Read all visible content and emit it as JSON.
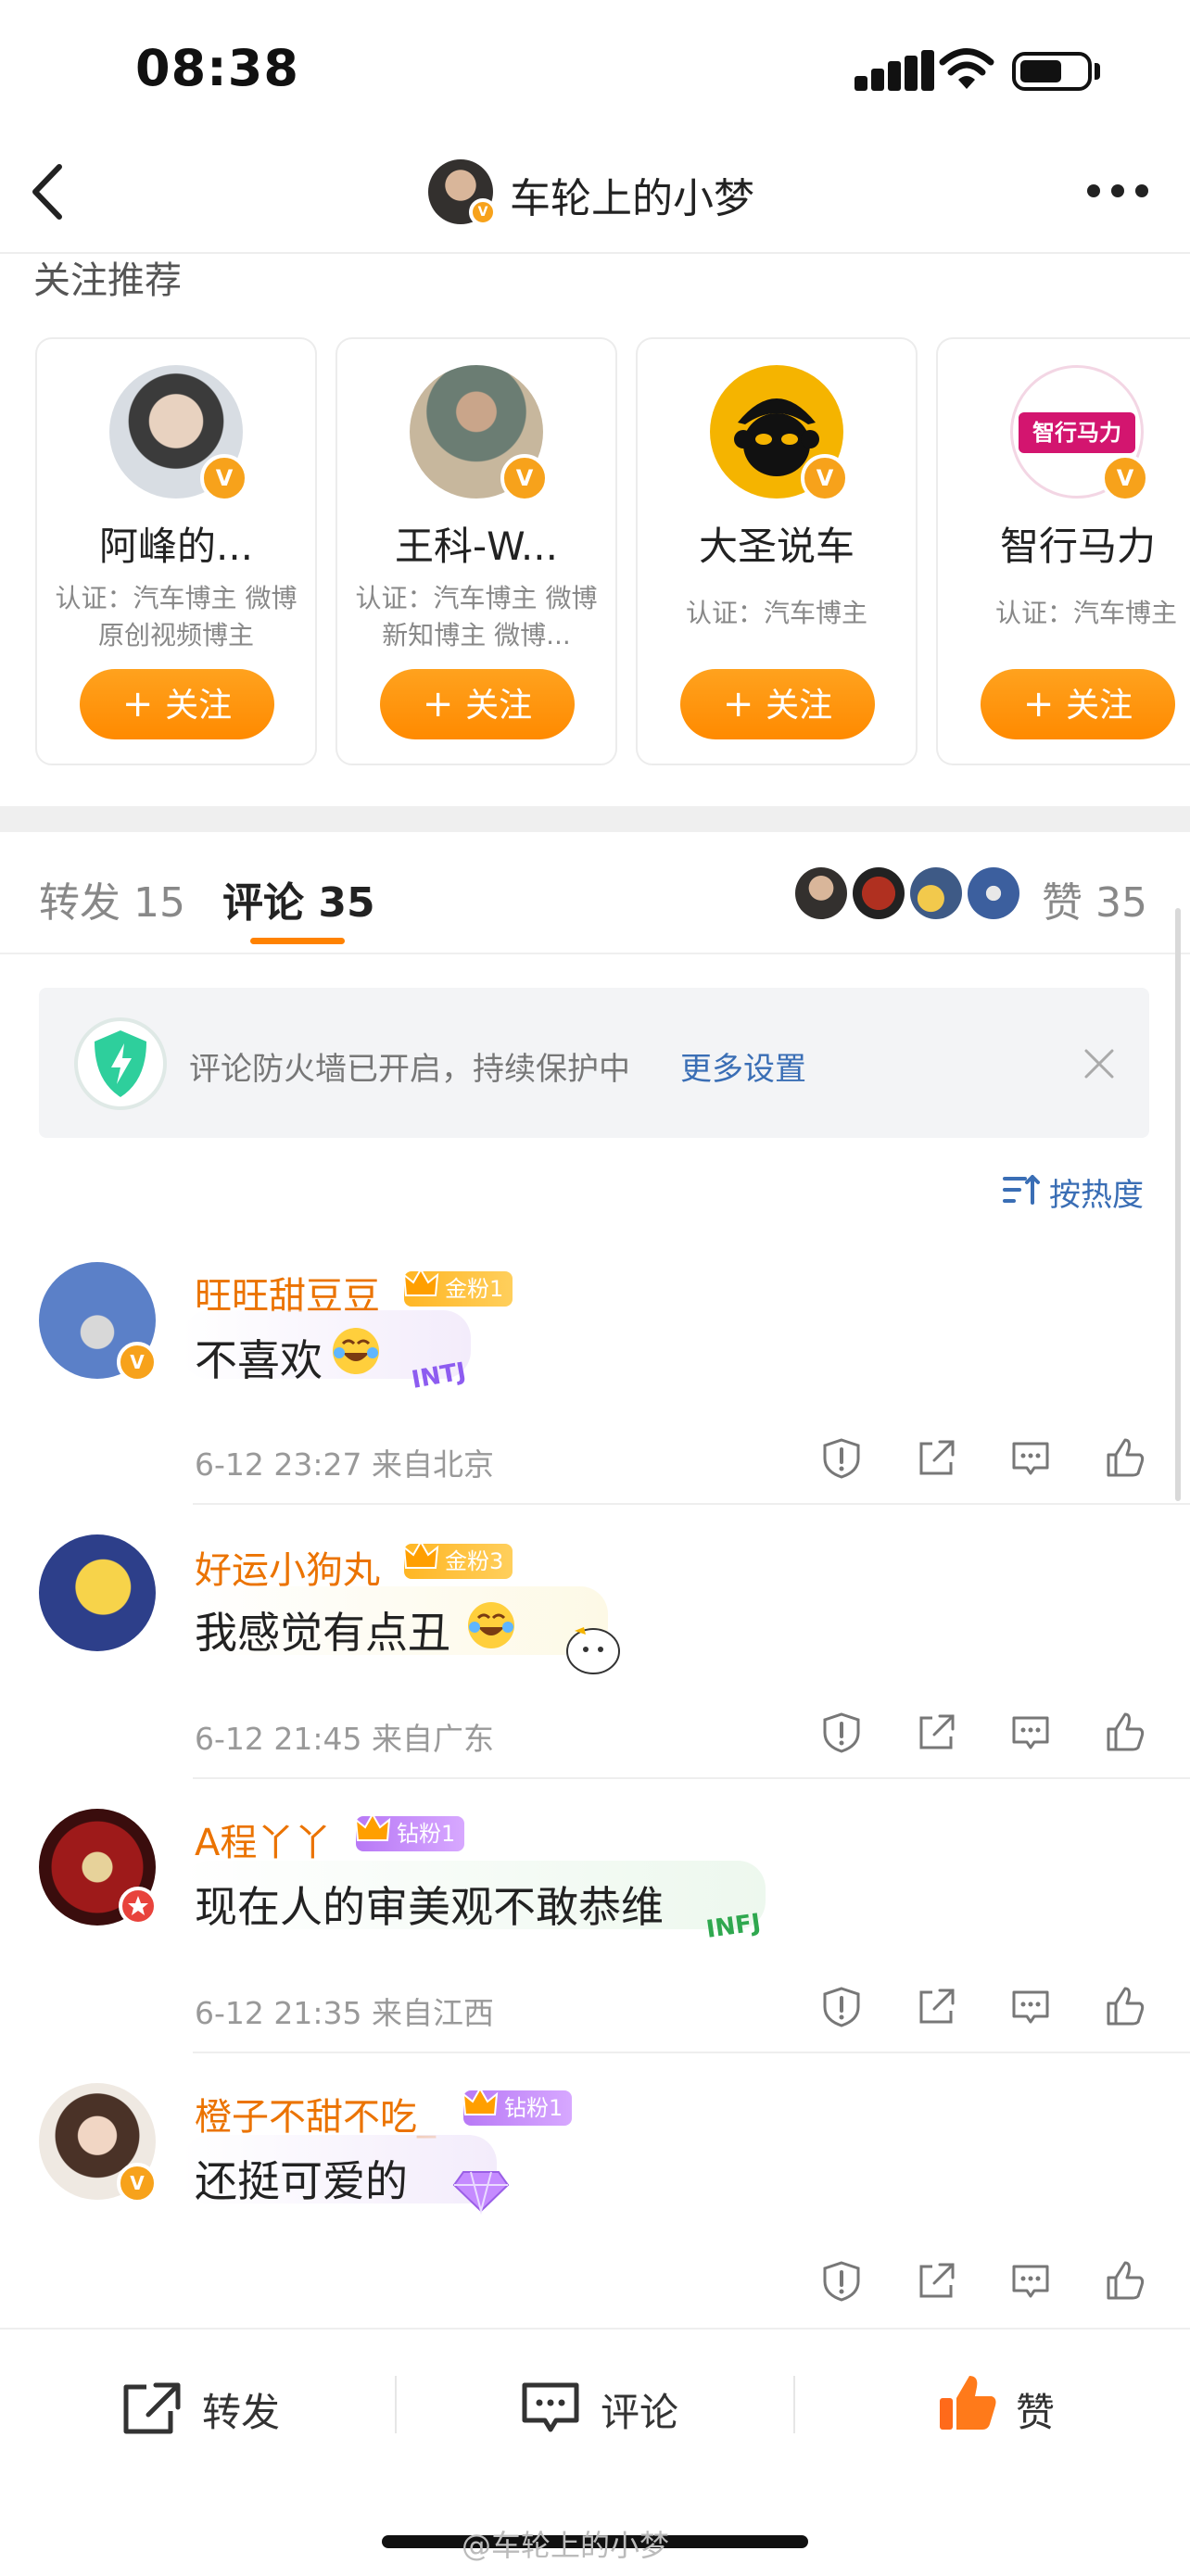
{
  "status_bar": {
    "time": "08:38"
  },
  "nav": {
    "title": "车轮上的小梦"
  },
  "recommend": {
    "title": "关注推荐",
    "follow_label": "关注",
    "cards": [
      {
        "name": "阿峰的...",
        "cert": "认证：汽车博主 微博原创视频博主"
      },
      {
        "name": "王科-W...",
        "cert": "认证：汽车博主 微博新知博主 微博..."
      },
      {
        "name": "大圣说车",
        "cert": "认证：汽车博主"
      },
      {
        "name": "智行马力",
        "cert": "认证：汽车博主",
        "logo_text": "智行马力"
      }
    ]
  },
  "tabs": {
    "repost": "转发 15",
    "comment_label": "评论",
    "comment_count": "35",
    "like": "赞 35"
  },
  "firewall": {
    "text": "评论防火墙已开启，持续保护中",
    "link": "更多设置"
  },
  "sort": {
    "label": "按热度"
  },
  "comments": [
    {
      "name": "旺旺甜豆豆",
      "badge": "金粉1",
      "badge_level": "6",
      "text": "不喜欢",
      "meta": "6-12 23:27 来自北京",
      "bubble_tag": "INTJ"
    },
    {
      "name": "好运小狗丸",
      "badge": "金粉3",
      "badge_level": "4",
      "text": "我感觉有点丑",
      "meta": "6-12 21:45 来自广东"
    },
    {
      "name": "A程丫丫",
      "badge": "钻粉1",
      "badge_level": "4",
      "text": "现在人的审美观不敢恭维",
      "meta": "6-12 21:35 来自江西",
      "bubble_tag": "INFJ"
    },
    {
      "name": "橙子不甜不吃_",
      "badge": "钻粉1",
      "badge_level": "5",
      "text": "还挺可爱的",
      "meta": ""
    }
  ],
  "bottom_bar": {
    "repost": "转发",
    "comment": "评论",
    "like": "赞"
  },
  "watermark": "@车轮上的小梦",
  "colors": {
    "accent": "#ff8200",
    "link": "#3a6eb5",
    "name": "#eb7300"
  }
}
